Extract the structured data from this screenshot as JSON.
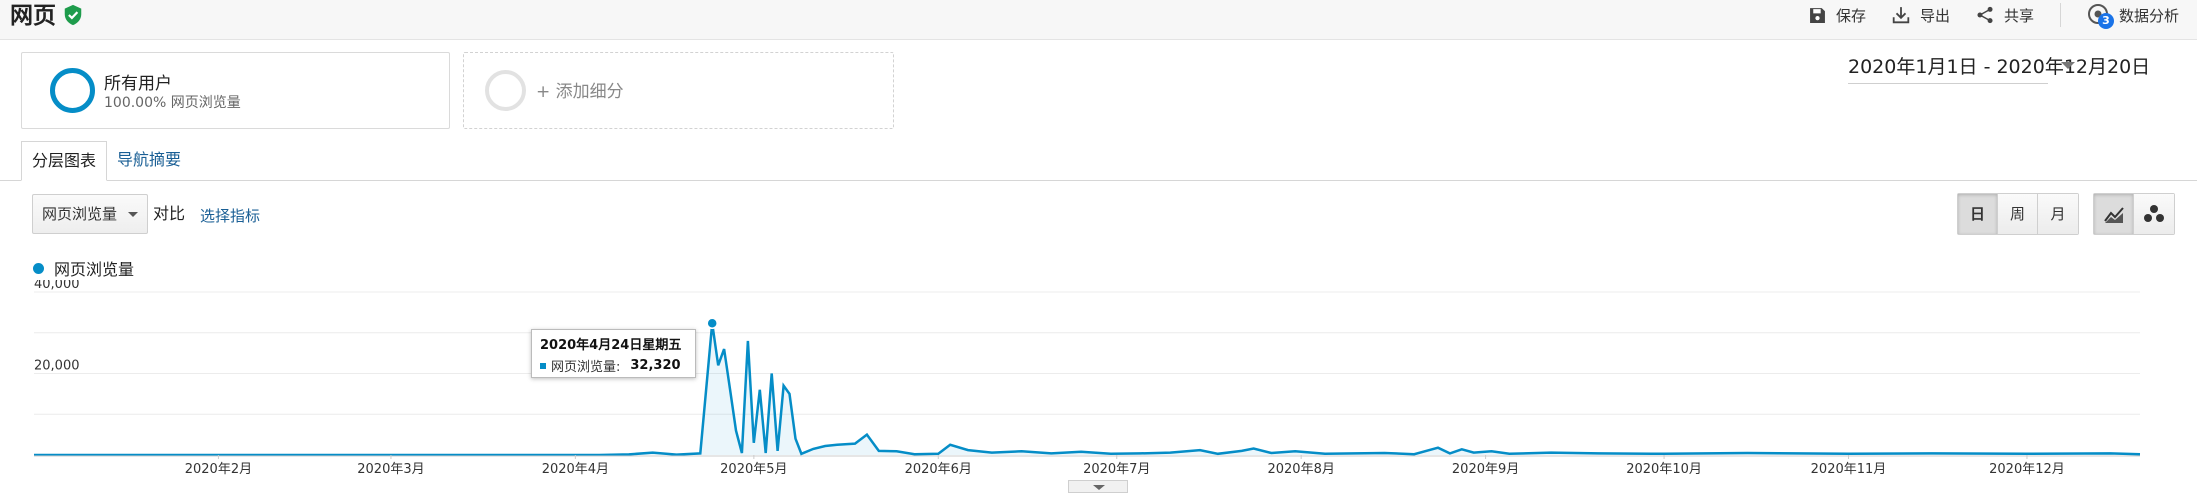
{
  "header": {
    "title": "网页",
    "actions": {
      "save": "保存",
      "export": "导出",
      "share": "共享",
      "insights": "数据分析",
      "insights_badge": "3"
    }
  },
  "segments": [
    {
      "name": "所有用户",
      "sub": "100.00% 网页浏览量"
    },
    {
      "add_label": "+ 添加细分"
    }
  ],
  "date_range": "2020年1月1日 - 2020年12月20日",
  "tabs": [
    {
      "label": "分层图表"
    },
    {
      "label": "导航摘要"
    }
  ],
  "controls": {
    "metric": "网页浏览量",
    "vs_label": "对比",
    "choose_metric": "选择指标",
    "granularity": [
      "日",
      "周",
      "月"
    ],
    "active_granularity": "日"
  },
  "legend": {
    "label": "网页浏览量",
    "color": "#058dc7"
  },
  "tooltip": {
    "date": "2020年4月24日星期五",
    "metric": "网页浏览量:",
    "value": "32,320"
  },
  "chart_data": {
    "type": "area",
    "series_name": "网页浏览量",
    "y_ticks": [
      "40,000",
      "20,000"
    ],
    "ylim": [
      0,
      40000
    ],
    "x_tick_labels": [
      "2020年2月",
      "2020年3月",
      "2020年4月",
      "2020年5月",
      "2020年6月",
      "2020年7月",
      "2020年8月",
      "2020年9月",
      "2020年10月",
      "2020年11月",
      "2020年12月"
    ],
    "x_tick_months": [
      2,
      3,
      4,
      5,
      6,
      7,
      8,
      9,
      10,
      11,
      12
    ],
    "highlight": {
      "date": "2020-04-24",
      "value": 32320
    },
    "points": [
      [
        "2020-01-01",
        0
      ],
      [
        "2020-04-05",
        0
      ],
      [
        "2020-04-10",
        150
      ],
      [
        "2020-04-14",
        600
      ],
      [
        "2020-04-18",
        100
      ],
      [
        "2020-04-22",
        400
      ],
      [
        "2020-04-24",
        32320
      ],
      [
        "2020-04-25",
        22000
      ],
      [
        "2020-04-26",
        26000
      ],
      [
        "2020-04-27",
        16000
      ],
      [
        "2020-04-28",
        6000
      ],
      [
        "2020-04-29",
        500
      ],
      [
        "2020-04-30",
        28000
      ],
      [
        "2020-05-01",
        3000
      ],
      [
        "2020-05-02",
        16000
      ],
      [
        "2020-05-03",
        500
      ],
      [
        "2020-05-04",
        20000
      ],
      [
        "2020-05-05",
        1000
      ],
      [
        "2020-05-06",
        17000
      ],
      [
        "2020-05-07",
        15000
      ],
      [
        "2020-05-08",
        4000
      ],
      [
        "2020-05-09",
        300
      ],
      [
        "2020-05-11",
        1500
      ],
      [
        "2020-05-13",
        2200
      ],
      [
        "2020-05-15",
        2500
      ],
      [
        "2020-05-18",
        2800
      ],
      [
        "2020-05-20",
        5000
      ],
      [
        "2020-05-22",
        1000
      ],
      [
        "2020-05-25",
        900
      ],
      [
        "2020-05-28",
        200
      ],
      [
        "2020-06-01",
        300
      ],
      [
        "2020-06-03",
        2500
      ],
      [
        "2020-06-06",
        1200
      ],
      [
        "2020-06-10",
        600
      ],
      [
        "2020-06-15",
        900
      ],
      [
        "2020-06-20",
        400
      ],
      [
        "2020-06-25",
        800
      ],
      [
        "2020-06-30",
        300
      ],
      [
        "2020-07-05",
        400
      ],
      [
        "2020-07-10",
        600
      ],
      [
        "2020-07-15",
        1200
      ],
      [
        "2020-07-18",
        300
      ],
      [
        "2020-07-22",
        1000
      ],
      [
        "2020-07-24",
        1600
      ],
      [
        "2020-07-27",
        500
      ],
      [
        "2020-07-31",
        900
      ],
      [
        "2020-08-05",
        300
      ],
      [
        "2020-08-15",
        500
      ],
      [
        "2020-08-20",
        200
      ],
      [
        "2020-08-24",
        1800
      ],
      [
        "2020-08-26",
        400
      ],
      [
        "2020-08-28",
        1400
      ],
      [
        "2020-08-30",
        600
      ],
      [
        "2020-09-02",
        900
      ],
      [
        "2020-09-05",
        300
      ],
      [
        "2020-09-12",
        600
      ],
      [
        "2020-09-20",
        400
      ],
      [
        "2020-10-01",
        300
      ],
      [
        "2020-10-15",
        500
      ],
      [
        "2020-11-01",
        300
      ],
      [
        "2020-11-15",
        400
      ],
      [
        "2020-12-01",
        300
      ],
      [
        "2020-12-15",
        400
      ],
      [
        "2020-12-20",
        200
      ]
    ]
  }
}
